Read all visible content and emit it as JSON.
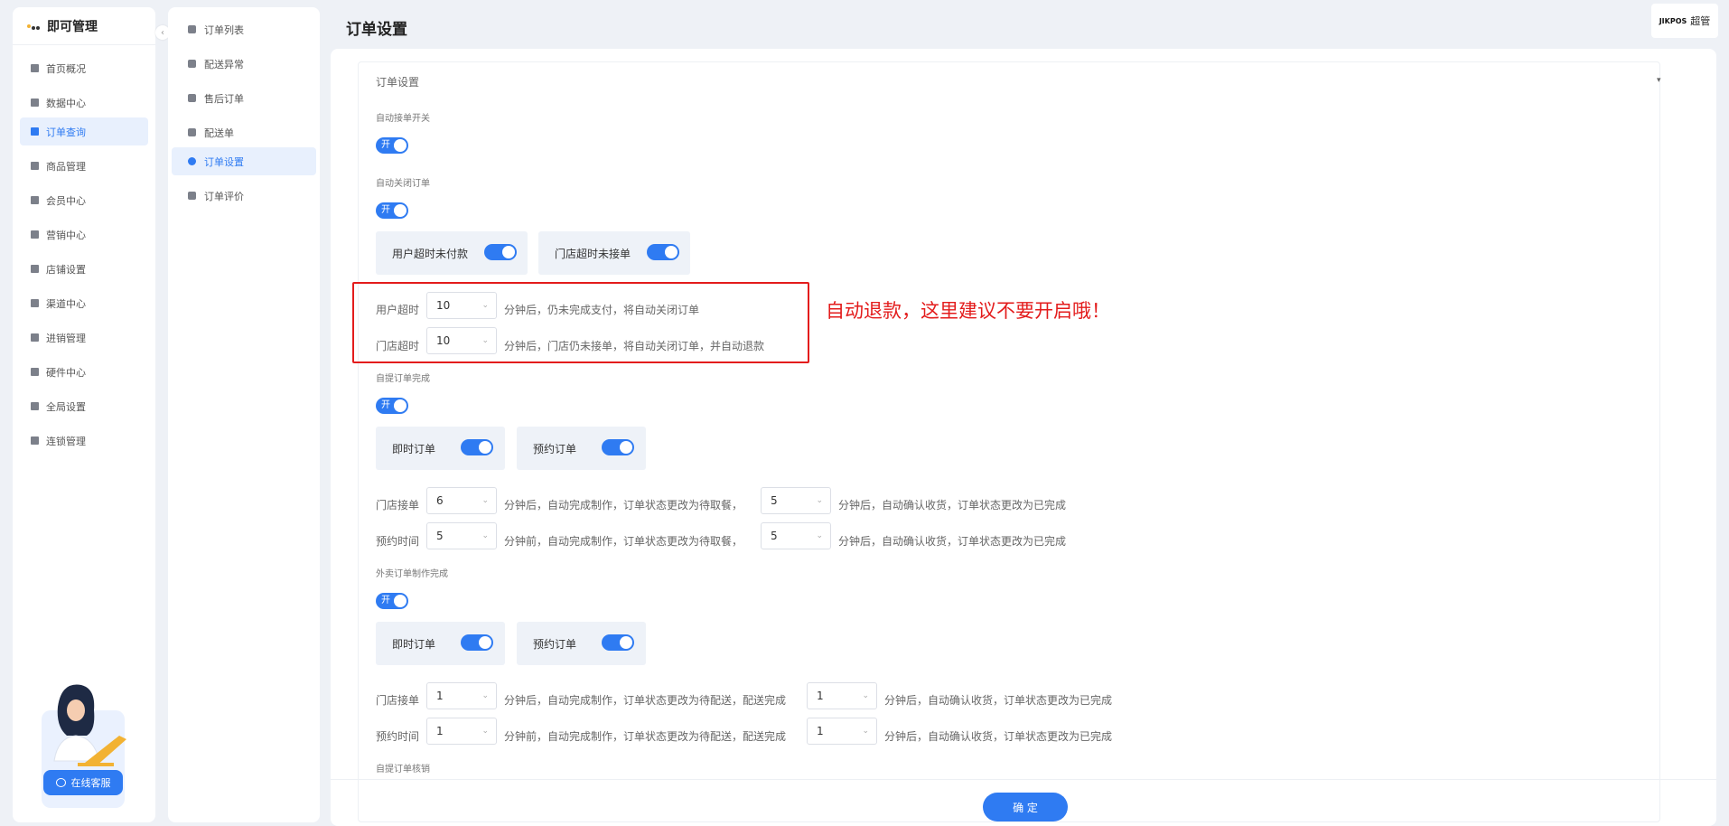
{
  "app": {
    "title": "即可管理",
    "collapse_glyph": "‹"
  },
  "sidebar": {
    "items": [
      {
        "label": "首页概况",
        "icon": "dashboard-icon"
      },
      {
        "label": "数据中心",
        "icon": "bar-chart-icon"
      },
      {
        "label": "订单查询",
        "icon": "order-icon",
        "active": true
      },
      {
        "label": "商品管理",
        "icon": "bag-icon"
      },
      {
        "label": "会员中心",
        "icon": "member-icon"
      },
      {
        "label": "营销中心",
        "icon": "marketing-icon"
      },
      {
        "label": "店铺设置",
        "icon": "store-icon"
      },
      {
        "label": "渠道中心",
        "icon": "channel-icon"
      },
      {
        "label": "进销管理",
        "icon": "inventory-icon"
      },
      {
        "label": "硬件中心",
        "icon": "hardware-icon"
      },
      {
        "label": "全局设置",
        "icon": "gear-icon"
      },
      {
        "label": "连锁管理",
        "icon": "shield-icon"
      }
    ],
    "support_button": "在线客服"
  },
  "submenu": {
    "items": [
      {
        "label": "订单列表",
        "icon": "list-icon"
      },
      {
        "label": "配送异常",
        "icon": "warning-icon"
      },
      {
        "label": "售后订单",
        "icon": "after-sale-icon"
      },
      {
        "label": "配送单",
        "icon": "truck-icon"
      },
      {
        "label": "订单设置",
        "icon": "gear-icon",
        "active": true
      },
      {
        "label": "订单评价",
        "icon": "review-icon"
      }
    ]
  },
  "header": {
    "page_title": "订单设置",
    "user_logo": "JIKPOS",
    "user_name": "超管"
  },
  "card": {
    "title": "订单设置",
    "chevron": "▾",
    "auto_accept": {
      "label": "自动接单开关",
      "switch_text": "开"
    },
    "auto_close": {
      "label": "自动关闭订单",
      "switch_text": "开",
      "options": [
        "用户超时未付款",
        "门店超时未接单"
      ],
      "rows": [
        {
          "label": "用户超时",
          "value": "10",
          "text": "分钟后，仍未完成支付，将自动关闭订单"
        },
        {
          "label": "门店超时",
          "value": "10",
          "text": "分钟后，门店仍未接单，将自动关闭订单，并自动退款"
        }
      ]
    },
    "self_pickup": {
      "label": "自提订单完成",
      "switch_text": "开",
      "options": [
        "即时订单",
        "预约订单"
      ],
      "rows": [
        {
          "label": "门店接单",
          "value1": "6",
          "text1": "分钟后，自动完成制作，订单状态更改为待取餐，",
          "value2": "5",
          "text2": "分钟后，自动确认收货，订单状态更改为已完成"
        },
        {
          "label": "预约时间",
          "value1": "5",
          "text1": "分钟前，自动完成制作，订单状态更改为待取餐，",
          "value2": "5",
          "text2": "分钟后，自动确认收货，订单状态更改为已完成"
        }
      ]
    },
    "delivery": {
      "label": "外卖订单制作完成",
      "switch_text": "开",
      "options": [
        "即时订单",
        "预约订单"
      ],
      "rows": [
        {
          "label": "门店接单",
          "value1": "1",
          "text1": "分钟后，自动完成制作，订单状态更改为待配送，配送完成",
          "value2": "1",
          "text2": "分钟后，自动确认收货，订单状态更改为已完成"
        },
        {
          "label": "预约时间",
          "value1": "1",
          "text1": "分钟前，自动完成制作，订单状态更改为待配送，配送完成",
          "value2": "1",
          "text2": "分钟后，自动确认收货，订单状态更改为已完成"
        }
      ]
    },
    "self_pickup_verify": {
      "label": "自提订单核销"
    }
  },
  "annotation": "自动退款，这里建议不要开启哦！",
  "footer": {
    "ok_button": "确 定"
  },
  "colors": {
    "accent": "#2f7bf2",
    "annotation": "#e31c1c"
  }
}
